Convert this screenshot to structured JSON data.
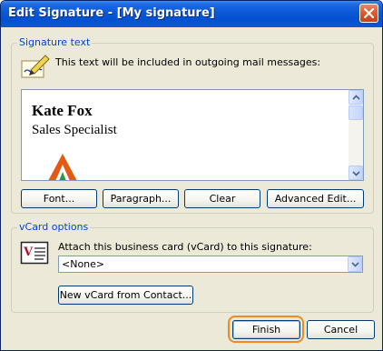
{
  "window": {
    "title": "Edit Signature - [My signature]"
  },
  "signature_group": {
    "label": "Signature text",
    "description": "This text will be included in outgoing mail messages:",
    "editor": {
      "name": "Kate Fox",
      "job_title": "Sales Specialist"
    },
    "buttons": {
      "font": "Font...",
      "paragraph": "Paragraph...",
      "clear": "Clear",
      "advanced_edit": "Advanced Edit..."
    }
  },
  "vcard_group": {
    "label": "vCard options",
    "attach_label": "Attach this business card (vCard) to this signature:",
    "selected_card": "<None>",
    "new_vcard_button": "New vCard from Contact..."
  },
  "footer": {
    "finish": "Finish",
    "cancel": "Cancel"
  },
  "icons": [
    "close-icon",
    "signature-pen-icon",
    "logo-image",
    "vcard-icon",
    "chevron-up-icon",
    "chevron-down-icon"
  ],
  "colors": {
    "titlebar": "#0a58d8",
    "group_label": "#0046d5",
    "focus_ring": "#f08a24",
    "logo": "#e35a12"
  }
}
